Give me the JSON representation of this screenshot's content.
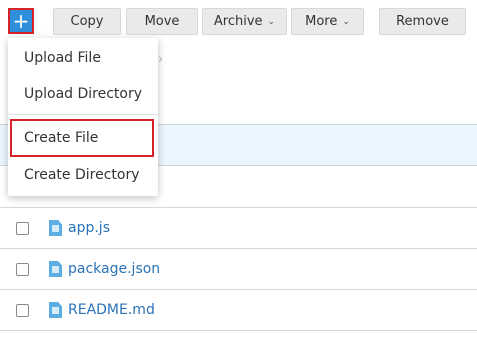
{
  "toolbar": {
    "add_icon_glyph": "+",
    "copy_label": "Copy",
    "move_label": "Move",
    "archive_label": "Archive",
    "more_label": "More",
    "remove_label": "Remove",
    "dropdown_glyph": "⌄"
  },
  "breadcrumb": {
    "separator": "›"
  },
  "menu": {
    "items": [
      {
        "label": "Upload File"
      },
      {
        "label": "Upload Directory"
      },
      {
        "label": "Create File"
      },
      {
        "label": "Create Directory"
      }
    ]
  },
  "files": [
    {
      "name": "app.js"
    },
    {
      "name": "package.json"
    },
    {
      "name": "README.md"
    }
  ],
  "colors": {
    "accent": "#2f8fdb",
    "highlight_border": "#d6232a",
    "link": "#2a73b7",
    "row_highlight": "#eaf6fd"
  }
}
